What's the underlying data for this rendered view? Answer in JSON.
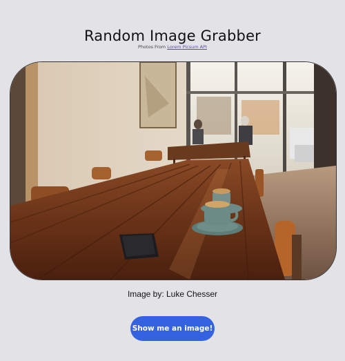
{
  "app": {
    "title": "Random Image Grabber"
  },
  "credit": {
    "prefix": "Photos From ",
    "link_text": "Lorem Picsum API"
  },
  "image": {
    "author_prefix": "Image by: ",
    "author_name": "Luke Chesser"
  },
  "actions": {
    "show_button_label": "Show me an image!"
  },
  "colors": {
    "background": "#e3e3e7",
    "button": "#3563e0",
    "link": "#5a4ea3"
  }
}
